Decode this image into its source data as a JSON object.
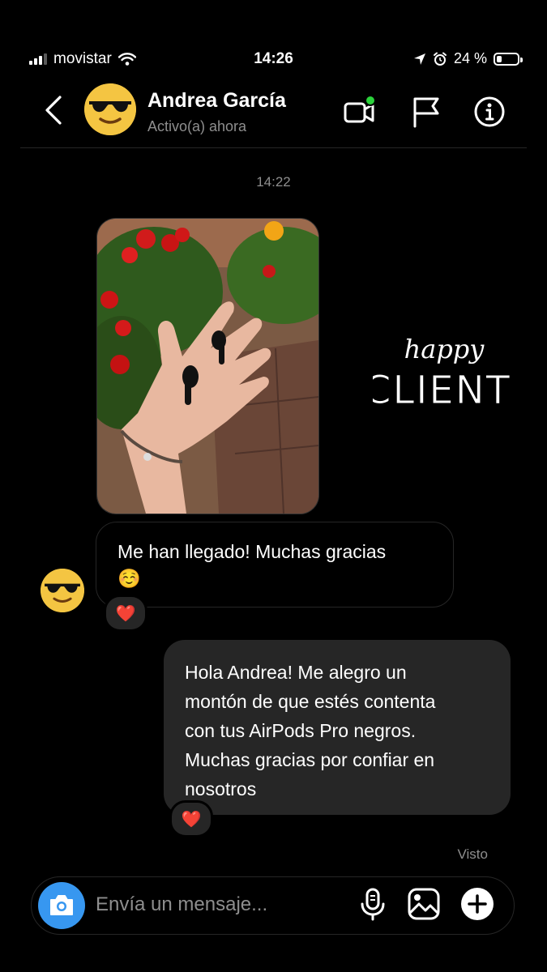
{
  "status_bar": {
    "carrier": "movistar",
    "time": "14:26",
    "battery": "24 %",
    "battery_level": 0.24
  },
  "header": {
    "name": "Andrea García",
    "status": "Activo(a) ahora",
    "icons": [
      "back-icon",
      "video-call-icon",
      "flag-icon",
      "info-icon"
    ]
  },
  "conversation": {
    "timestamp": "14:22",
    "overlay_text": {
      "line1": "happy",
      "line2": "CLIENT"
    },
    "incoming": {
      "text": "Me han llegado! Muchas gracias",
      "emoji": "☺️",
      "reaction": "❤️"
    },
    "outgoing": {
      "lines": [
        "Hola Andrea! Me alegro un",
        "montón de que estés contenta",
        "con tus AirPods Pro negros.",
        "Muchas gracias por confiar en",
        "nosotros"
      ],
      "reaction": "❤️"
    },
    "seen_label": "Visto"
  },
  "composer": {
    "placeholder": "Envía un mensaje...",
    "icons": [
      "camera-icon",
      "microphone-icon",
      "gallery-icon",
      "plus-icon"
    ]
  },
  "colors": {
    "background": "#000000",
    "bubble_out": "#262626",
    "secondary_text": "#8e8e8e",
    "accent_blue": "#3797f0",
    "online_green": "#2bd23b"
  }
}
